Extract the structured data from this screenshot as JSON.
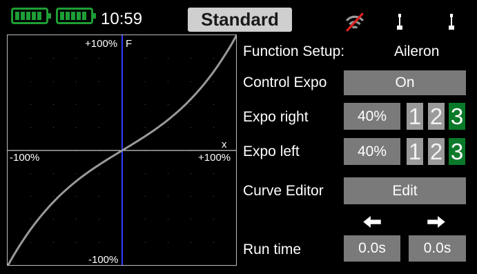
{
  "status_bar": {
    "time": "10:59",
    "mode": "Standard",
    "battery_color": "#1e9e35"
  },
  "graph": {
    "top_label": "+100%",
    "f_label": "F",
    "x_label": "x",
    "left_label": "-100%",
    "right_label": "+100%",
    "bottom_label": "-100%",
    "curve_color": "#9a9a9a",
    "axis_color": "#2f3cff",
    "expo": 40
  },
  "function_setup": {
    "label": "Function Setup:",
    "value": "Aileron"
  },
  "control_expo": {
    "label": "Control Expo",
    "value": "On"
  },
  "expo_right": {
    "label": "Expo right",
    "value": "40%",
    "rates": [
      "1",
      "2",
      "3"
    ],
    "active_rate": "3"
  },
  "expo_left": {
    "label": "Expo left",
    "value": "40%",
    "rates": [
      "1",
      "2",
      "3"
    ],
    "active_rate": "3"
  },
  "curve_editor": {
    "label": "Curve Editor",
    "value": "Edit"
  },
  "run_time": {
    "label": "Run time",
    "left_value": "0.0s",
    "right_value": "0.0s",
    "left_arrow": "arrow-left-icon",
    "right_arrow": "arrow-right-icon"
  }
}
